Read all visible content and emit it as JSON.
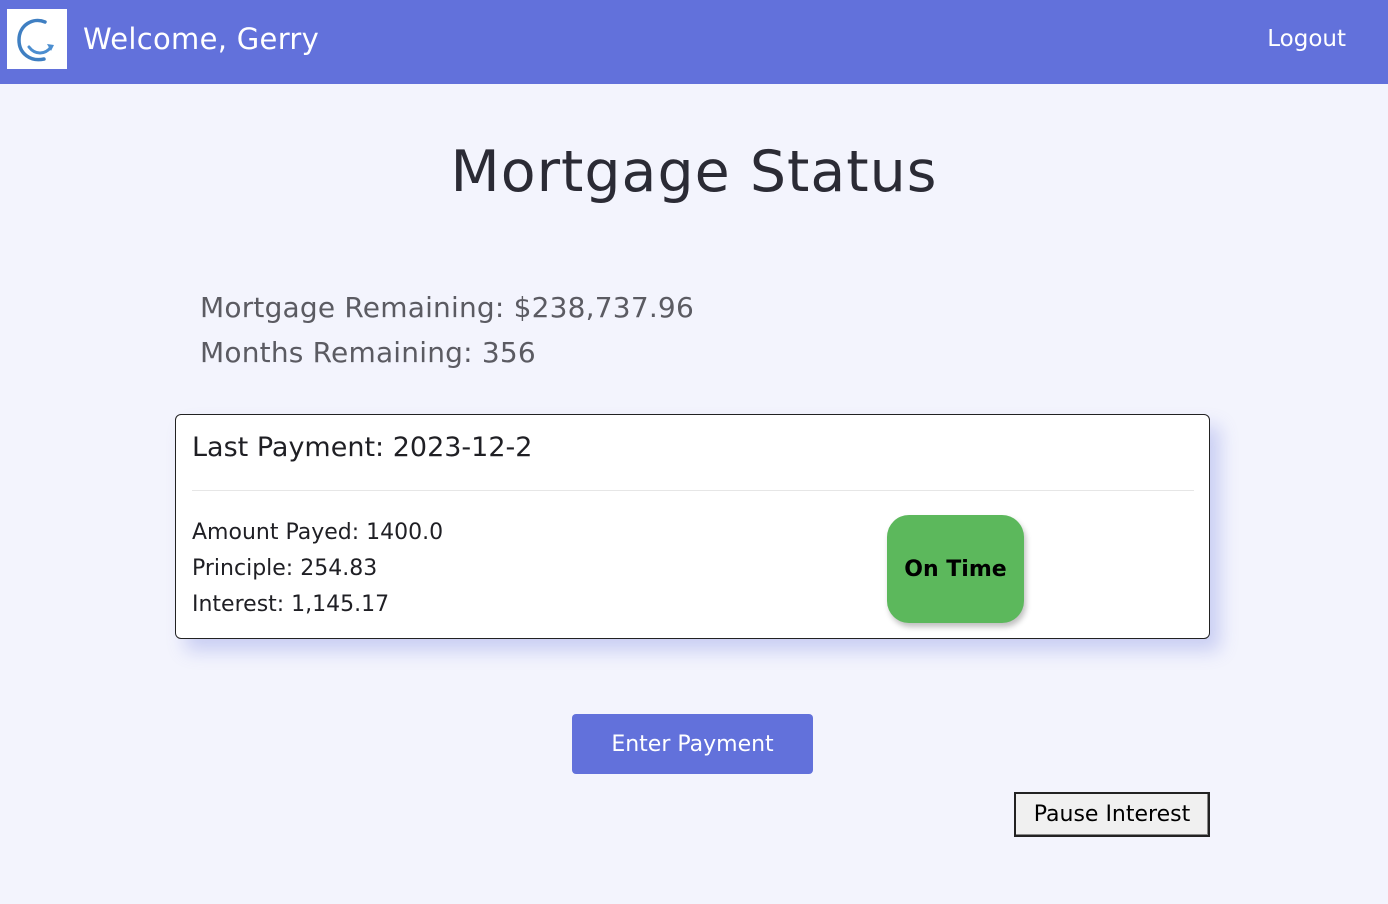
{
  "header": {
    "welcome_text": "Welcome, Gerry",
    "logout_label": "Logout",
    "logo_icon": "g-arrow-logo-icon",
    "bar_color": "#6271db"
  },
  "main": {
    "title": "Mortgage Status",
    "mortgage_remaining": "Mortgage Remaining: $238,737.96",
    "months_remaining": "Months Remaining: 356"
  },
  "last_payment": {
    "title": "Last Payment: 2023-12-2",
    "amount_payed": "Amount Payed: 1400.0",
    "principle": "Principle: 254.83",
    "interest": "Interest: 1,145.17",
    "status_label": "On Time",
    "status_color": "#5cb85c"
  },
  "actions": {
    "enter_payment_label": "Enter Payment",
    "pause_interest_label": "Pause Interest"
  }
}
